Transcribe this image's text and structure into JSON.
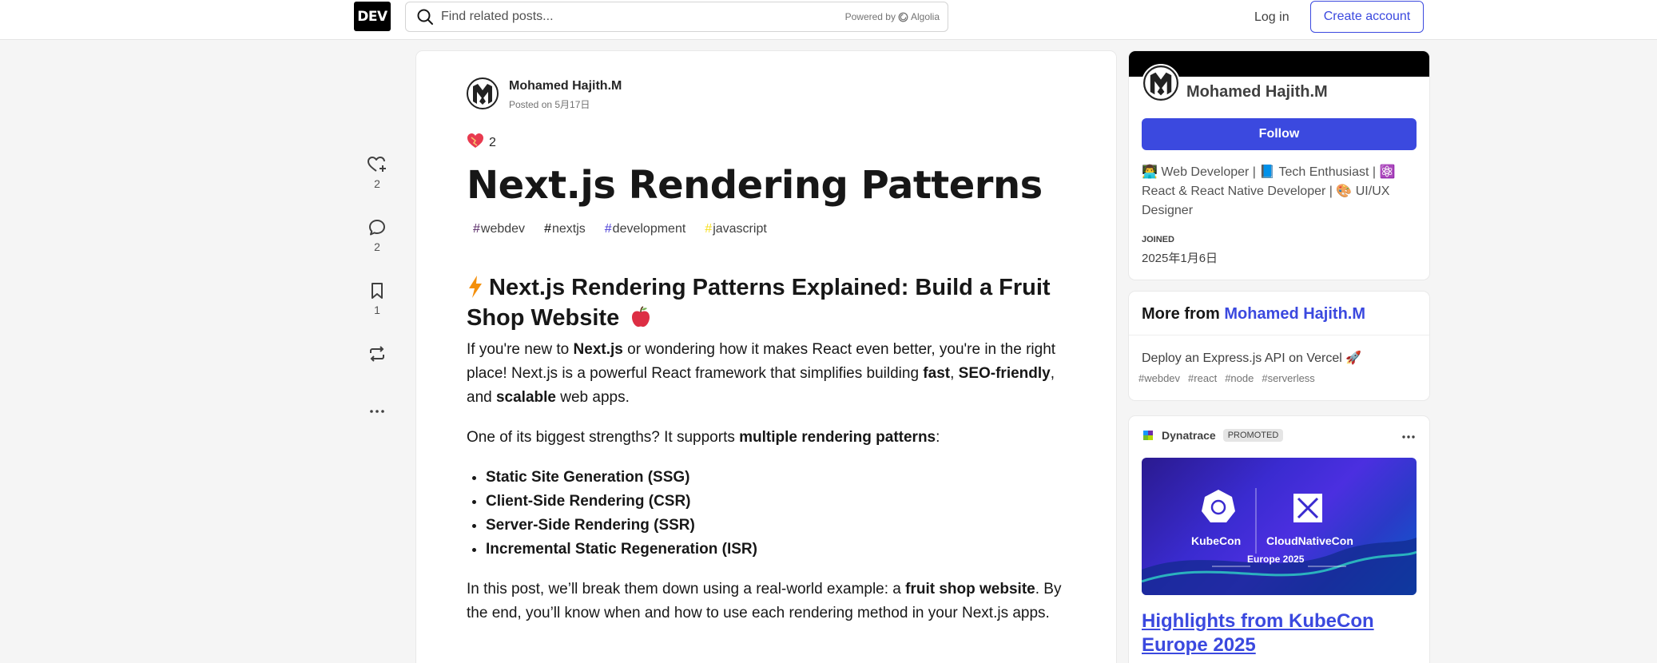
{
  "header": {
    "logo": "DEV",
    "search_placeholder": "Find related posts...",
    "powered_by": "Powered by",
    "algolia": "Algolia",
    "login": "Log in",
    "create_account": "Create account"
  },
  "reactions": {
    "likes": "2",
    "comments": "2",
    "bookmarks": "1"
  },
  "article": {
    "author": "Mohamed Hajith.M",
    "posted": "Posted on 5月17日",
    "reaction_emoji": "❤️",
    "reaction_count": "2",
    "title": "Next.js Rendering Patterns",
    "tags": [
      {
        "name": "webdev",
        "color": "#562765"
      },
      {
        "name": "nextjs",
        "color": "#000000"
      },
      {
        "name": "development",
        "color": "#4a3dd6"
      },
      {
        "name": "javascript",
        "color": "#f7df1e"
      }
    ],
    "heading": "⚡ Next.js Rendering Patterns Explained: Build a Fruit Shop Website 🍎",
    "heading_icon": "lightning-bolt",
    "heading_text": "Next.js Rendering Patterns Explained: Build a Fruit Shop Website",
    "heading_emoji": "🍎",
    "p1_a": "If you're new to ",
    "p1_b": "Next.js",
    "p1_c": " or wondering how it makes React even better, you're in the right place! Next.js is a powerful React framework that simplifies building ",
    "p1_d": "fast",
    "p1_e": ", ",
    "p1_f": "SEO-friendly",
    "p1_g": ", and ",
    "p1_h": "scalable",
    "p1_i": " web apps.",
    "p2_a": "One of its biggest strengths? It supports ",
    "p2_b": "multiple rendering patterns",
    "p2_c": ":",
    "list": [
      "Static Site Generation (SSG)",
      "Client-Side Rendering (CSR)",
      "Server-Side Rendering (SSR)",
      "Incremental Static Regeneration (ISR)"
    ],
    "p3_a": "In this post, we’ll break them down using a real-world example: a ",
    "p3_b": "fruit shop website",
    "p3_c": ". By the end, you’ll know when and how to use each rendering method in your Next.js apps."
  },
  "profile": {
    "name": "Mohamed Hajith.M",
    "follow": "Follow",
    "bio": "👨‍💻 Web Developer | 📘 Tech Enthusiast | ⚛️ React & React Native Developer | 🎨 UI/UX Designer",
    "joined_label": "Joined",
    "joined_value": "2025年1月6日"
  },
  "more_from": {
    "label": "More from ",
    "author": "Mohamed Hajith.M",
    "post_title": "Deploy an Express.js API on Vercel 🚀",
    "tags": [
      "#webdev",
      "#react",
      "#node",
      "#serverless"
    ]
  },
  "promo": {
    "brand": "Dynatrace",
    "badge": "PROMOTED",
    "banner_left": "KubeCon",
    "banner_right": "CloudNativeCon",
    "banner_sub": "Europe 2025",
    "title": "Highlights from KubeCon Europe 2025"
  },
  "colors": {
    "accent": "#3b49df",
    "background": "#f5f5f5"
  }
}
